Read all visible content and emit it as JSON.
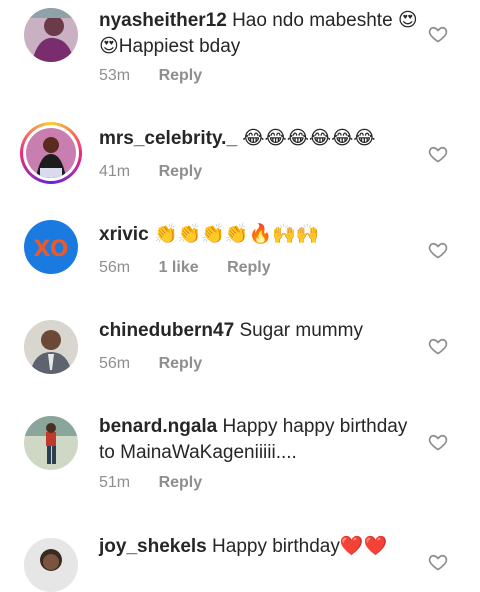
{
  "comments": [
    {
      "username": "nyasheither12",
      "text": "Hao ndo mabeshte 😍😍Happiest bday",
      "time": "53m",
      "likes": "",
      "reply": "Reply"
    },
    {
      "username": "mrs_celebrity._",
      "text": "😂😂😂😂😂😂",
      "time": "41m",
      "likes": "",
      "reply": "Reply"
    },
    {
      "username": "xrivic",
      "text": "👏👏👏👏🔥🙌🙌",
      "time": "56m",
      "likes": "1 like",
      "reply": "Reply"
    },
    {
      "username": "chinedubern47",
      "text": "Sugar mummy",
      "time": "56m",
      "likes": "",
      "reply": "Reply"
    },
    {
      "username": "benard.ngala",
      "text": "Happy happy birthday to MainaWaKageniiiii....",
      "time": "51m",
      "likes": "",
      "reply": "Reply"
    },
    {
      "username": "joy_shekels",
      "text": "Happy birthday❤️❤️",
      "time": "",
      "likes": "",
      "reply": ""
    }
  ],
  "avatar_icons": [
    "avatar-photo",
    "avatar-photo",
    "xo-logo-avatar",
    "avatar-photo",
    "avatar-photo",
    "avatar-photo"
  ],
  "colors": {
    "text": "#262626",
    "meta": "#8e8e8e",
    "heart_outline": "#8e8e8e"
  }
}
